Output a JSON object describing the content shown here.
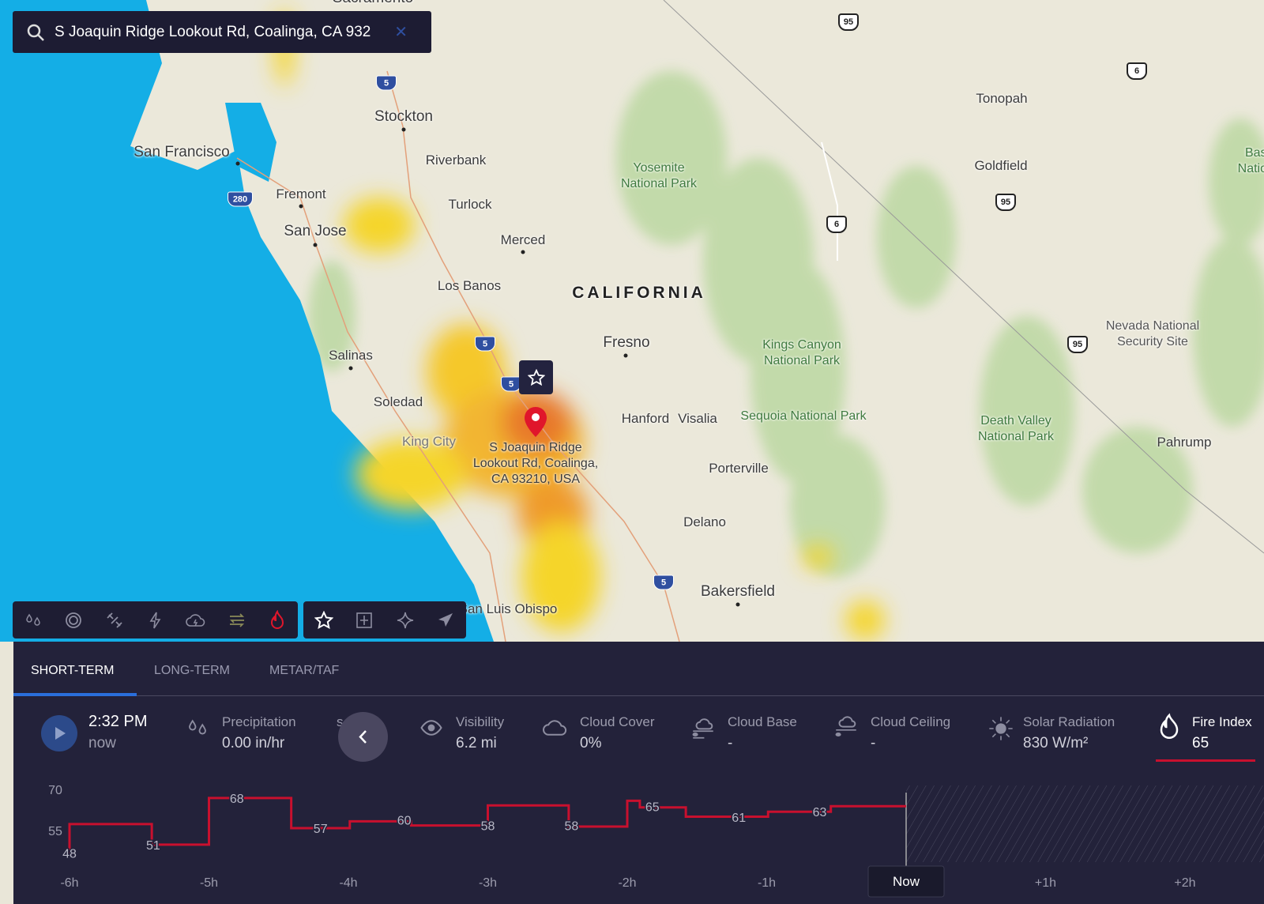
{
  "search": {
    "value": "S Joaquin Ridge Lookout Rd, Coalinga, CA 932",
    "icon": "search-icon",
    "clear_icon": "close-icon"
  },
  "map": {
    "state_label": "CALIFORNIA",
    "cities": [
      "Sacramento",
      "Stockton",
      "San Francisco",
      "Riverbank",
      "Fremont",
      "Turlock",
      "San Jose",
      "Merced",
      "Los Banos",
      "Fresno",
      "Salinas",
      "Soledad",
      "Hanford",
      "Visalia",
      "King City",
      "Porterville",
      "Delano",
      "Bakersfield",
      "San Luis Obispo",
      "Tonopah",
      "Goldfield",
      "Pahrump"
    ],
    "parks": [
      "Yosemite National Park",
      "Kings Canyon National Park",
      "Sequoia National Park",
      "Death Valley National Park",
      "Basin National"
    ],
    "areas": [
      "Nevada National Security Site"
    ],
    "shields": [
      "5",
      "5",
      "5",
      "5",
      "280",
      "95",
      "95",
      "95",
      "6",
      "6"
    ],
    "pin_label": "S Joaquin Ridge Lookout Rd, Coalinga, CA 93210, USA",
    "colors": {
      "ocean": "#14aee6",
      "land": "#ebe8da",
      "park": "#b9d7a0",
      "fire_low": "#f5d52a",
      "fire_high": "#e8782a",
      "pin": "#e0162b"
    }
  },
  "toolbar": {
    "layers": [
      "precipitation-icon",
      "radar-icon",
      "satellite-icon",
      "lightning-icon",
      "storm-icon",
      "wind-icon",
      "fire-icon"
    ],
    "active_layer": "fire-icon",
    "tools": [
      "favorite-star-icon",
      "airport-icon",
      "sparkle-icon",
      "airplane-icon"
    ]
  },
  "panel": {
    "tabs": [
      {
        "label": "SHORT-TERM",
        "active": true
      },
      {
        "label": "LONG-TERM"
      },
      {
        "label": "METAR/TAF"
      }
    ],
    "time": {
      "value": "2:32 PM",
      "sub": "now"
    },
    "metrics": [
      {
        "label": "Precipitation",
        "value": "0.00 in/hr"
      },
      {
        "label": "s",
        "value": ""
      },
      {
        "label": "Visibility",
        "value": "6.2 mi"
      },
      {
        "label": "Cloud Cover",
        "value": "0%"
      },
      {
        "label": "Cloud Base",
        "value": "-"
      },
      {
        "label": "Cloud Ceiling",
        "value": "-"
      },
      {
        "label": "Solar Radiation",
        "value": "830 W/m²"
      },
      {
        "label": "Fire Index",
        "value": "65",
        "active": true
      }
    ],
    "accent": "#c8102e"
  },
  "chart_data": {
    "type": "line",
    "step": true,
    "yticks": [
      "70",
      "55"
    ],
    "xticks": [
      "-6h",
      "-5h",
      "-4h",
      "-3h",
      "-2h",
      "-1h",
      "Now",
      "+1h",
      "+2h"
    ],
    "now_label": "Now",
    "steps": [
      [
        -6.0,
        48
      ],
      [
        -6.0,
        58.5
      ],
      [
        -5.41,
        51
      ],
      [
        -5.0,
        68
      ],
      [
        -4.41,
        57
      ],
      [
        -3.99,
        59.5
      ],
      [
        -3.55,
        58
      ],
      [
        -3.0,
        65.3
      ],
      [
        -2.42,
        57.6
      ],
      [
        -2.0,
        67
      ],
      [
        -1.91,
        64.6
      ],
      [
        -1.58,
        61.2
      ],
      [
        -0.99,
        63
      ],
      [
        -0.54,
        65
      ],
      [
        0,
        65
      ]
    ],
    "labels": [
      [
        -6.0,
        "48"
      ],
      [
        -5.4,
        "51"
      ],
      [
        -4.8,
        "68"
      ],
      [
        -4.2,
        "57"
      ],
      [
        -3.6,
        "60"
      ],
      [
        -3.0,
        "58"
      ],
      [
        -2.4,
        "58"
      ],
      [
        -1.82,
        "65"
      ],
      [
        -1.2,
        "61"
      ],
      [
        -0.62,
        "63"
      ]
    ],
    "future_hatched": true,
    "line_color": "#c8102e"
  }
}
